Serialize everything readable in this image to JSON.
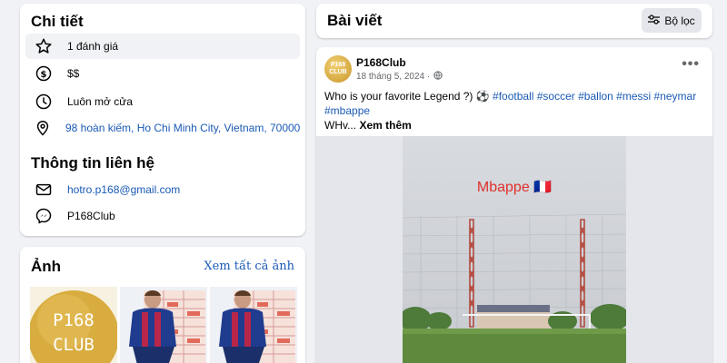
{
  "details": {
    "title": "Chi tiết",
    "items": [
      {
        "icon": "star-icon",
        "text": "1 đánh giá"
      },
      {
        "icon": "dollar-icon",
        "text": "$$"
      },
      {
        "icon": "clock-icon",
        "text": "Luôn mở cửa"
      },
      {
        "icon": "location-pin-icon",
        "text": "98 hoàn kiếm, Ho Chi Minh City, Vietnam, 70000"
      }
    ],
    "contact_title": "Thông tin liên hệ",
    "contact": [
      {
        "icon": "email-icon",
        "text": "hotro.p168@gmail.com"
      },
      {
        "icon": "messenger-icon",
        "text": "P168Club"
      }
    ]
  },
  "photos": {
    "title": "Ảnh",
    "see_all": "Xem tất cả ảnh",
    "logo_line1": "P168",
    "logo_line2": "CLUB"
  },
  "posts": {
    "title": "Bài viết",
    "filter_label": "Bộ lọc"
  },
  "post": {
    "avatar_line1": "P168",
    "avatar_line2": "CLUB",
    "author": "P168Club",
    "date": "18 tháng 5, 2024 ·",
    "text_intro": "Who is your favorite Legend ?) ⚽ ",
    "hashtags": [
      "#football",
      "#soccer",
      "#ballon",
      "#messi",
      "#neymar",
      "#mbappe"
    ],
    "text_trail": "WHv...",
    "see_more": "Xem thêm",
    "image_caption": "Mbappe 🇫🇷"
  },
  "colors": {
    "link": "#1a5ab5",
    "background": "#f0f2f5",
    "gold": "#d8ac3f"
  }
}
